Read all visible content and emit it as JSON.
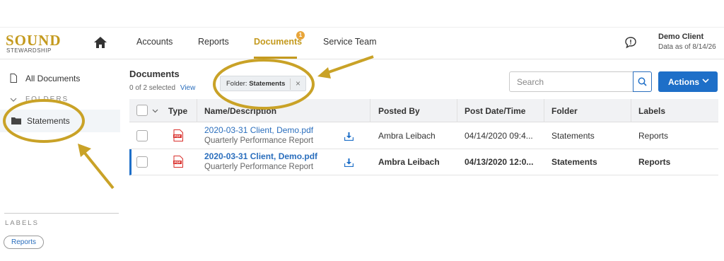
{
  "brand": {
    "line1": "SOUND",
    "line2": "STEWARDSHIP"
  },
  "nav": {
    "items": [
      {
        "label": "Accounts"
      },
      {
        "label": "Reports"
      },
      {
        "label": "Documents",
        "badge": "1"
      },
      {
        "label": "Service Team"
      }
    ],
    "active": "Documents"
  },
  "user": {
    "name": "Demo Client",
    "as_of": "Data as of 8/14/26"
  },
  "sidebar": {
    "all_documents": "All Documents",
    "folders_heading": "FOLDERS",
    "folder": "Statements",
    "labels_heading": "LABELS",
    "label_chip": "Reports"
  },
  "main": {
    "title": "Documents",
    "selected_text": "0 of 2 selected",
    "view_link": "View",
    "filter_prefix": "Folder: ",
    "filter_value": "Statements",
    "filter_close": "×",
    "search_placeholder": "Search",
    "actions_label": "Actions"
  },
  "table": {
    "headers": {
      "type": "Type",
      "name": "Name/Description",
      "posted_by": "Posted By",
      "post_date": "Post Date/Time",
      "folder": "Folder",
      "labels": "Labels"
    },
    "rows": [
      {
        "name": "2020-03-31 Client, Demo.pdf",
        "description": "Quarterly Performance Report",
        "posted_by": "Ambra Leibach",
        "post_date": "04/14/2020 09:4...",
        "folder": "Statements",
        "labels": "Reports",
        "pdf_label": "PDF"
      },
      {
        "name": "2020-03-31 Client, Demo.pdf",
        "description": "Quarterly Performance Report",
        "posted_by": "Ambra Leibach",
        "post_date": "04/13/2020 12:0...",
        "folder": "Statements",
        "labels": "Reports",
        "pdf_label": "PDF"
      }
    ]
  },
  "colors": {
    "accent": "#c49a1e",
    "primary": "#1e6fc8",
    "pdf": "#d9302c"
  },
  "icons": [
    "home-icon",
    "message-icon",
    "document-icon",
    "chevron-down-icon",
    "folder-icon",
    "search-icon",
    "pdf-icon",
    "download-icon"
  ]
}
